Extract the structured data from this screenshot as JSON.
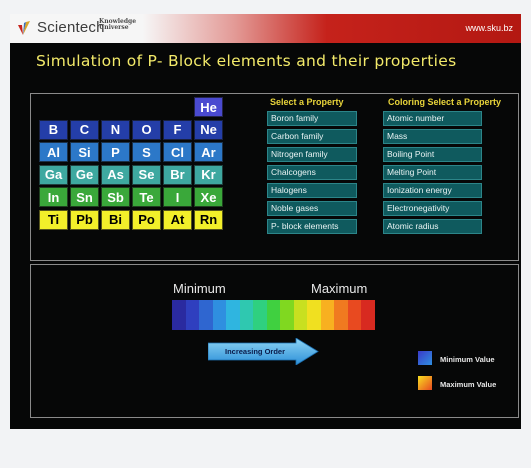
{
  "header": {
    "brand": "Scientech",
    "brand_sub_1": "Knowledge",
    "brand_sub_2": "Universe",
    "url": "www.sku.bz"
  },
  "title": "Simulation of P- Block elements and their properties",
  "periodic_table": {
    "elements": [
      {
        "symbol": "He",
        "row": 0,
        "col": 5,
        "color": "#4a4ad0"
      },
      {
        "symbol": "B",
        "row": 1,
        "col": 0,
        "color": "#243ea8"
      },
      {
        "symbol": "C",
        "row": 1,
        "col": 1,
        "color": "#243ea8"
      },
      {
        "symbol": "N",
        "row": 1,
        "col": 2,
        "color": "#243ea8"
      },
      {
        "symbol": "O",
        "row": 1,
        "col": 3,
        "color": "#243ea8"
      },
      {
        "symbol": "F",
        "row": 1,
        "col": 4,
        "color": "#243ea8"
      },
      {
        "symbol": "Ne",
        "row": 1,
        "col": 5,
        "color": "#243ea8"
      },
      {
        "symbol": "Al",
        "row": 2,
        "col": 0,
        "color": "#2c78c8"
      },
      {
        "symbol": "Si",
        "row": 2,
        "col": 1,
        "color": "#2c78c8"
      },
      {
        "symbol": "P",
        "row": 2,
        "col": 2,
        "color": "#2c78c8"
      },
      {
        "symbol": "S",
        "row": 2,
        "col": 3,
        "color": "#2c78c8"
      },
      {
        "symbol": "Cl",
        "row": 2,
        "col": 4,
        "color": "#2c78c8"
      },
      {
        "symbol": "Ar",
        "row": 2,
        "col": 5,
        "color": "#2c78c8"
      },
      {
        "symbol": "Ga",
        "row": 3,
        "col": 0,
        "color": "#3ea8a0"
      },
      {
        "symbol": "Ge",
        "row": 3,
        "col": 1,
        "color": "#3ea8a0"
      },
      {
        "symbol": "As",
        "row": 3,
        "col": 2,
        "color": "#3ea8a0"
      },
      {
        "symbol": "Se",
        "row": 3,
        "col": 3,
        "color": "#3ea8a0"
      },
      {
        "symbol": "Br",
        "row": 3,
        "col": 4,
        "color": "#3ea8a0"
      },
      {
        "symbol": "Kr",
        "row": 3,
        "col": 5,
        "color": "#3ea8a0"
      },
      {
        "symbol": "In",
        "row": 4,
        "col": 0,
        "color": "#3aa83a"
      },
      {
        "symbol": "Sn",
        "row": 4,
        "col": 1,
        "color": "#3aa83a"
      },
      {
        "symbol": "Sb",
        "row": 4,
        "col": 2,
        "color": "#3aa83a"
      },
      {
        "symbol": "Te",
        "row": 4,
        "col": 3,
        "color": "#3aa83a"
      },
      {
        "symbol": "I",
        "row": 4,
        "col": 4,
        "color": "#3aa83a"
      },
      {
        "symbol": "Xe",
        "row": 4,
        "col": 5,
        "color": "#3aa83a"
      },
      {
        "symbol": "Ti",
        "row": 5,
        "col": 0,
        "color": "#f2ef2a"
      },
      {
        "symbol": "Pb",
        "row": 5,
        "col": 1,
        "color": "#f2ef2a"
      },
      {
        "symbol": "Bi",
        "row": 5,
        "col": 2,
        "color": "#f2ef2a"
      },
      {
        "symbol": "Po",
        "row": 5,
        "col": 3,
        "color": "#f2ef2a"
      },
      {
        "symbol": "At",
        "row": 5,
        "col": 4,
        "color": "#f2ef2a"
      },
      {
        "symbol": "Rn",
        "row": 5,
        "col": 5,
        "color": "#f2ef2a"
      }
    ]
  },
  "property_panel": {
    "header": "Select a Property",
    "items": [
      "Boron family",
      "Carbon family",
      "Nitrogen family",
      "Chalcogens",
      "Halogens",
      "Noble gases",
      "P- block elements"
    ]
  },
  "coloring_panel": {
    "header": "Coloring Select a Property",
    "items": [
      "Atomic number",
      "Mass",
      "Boiling Point",
      "Melting Point",
      "Ionization energy",
      "Electronegativity",
      "Atomic radius"
    ]
  },
  "scale": {
    "min_label": "Minimum",
    "max_label": "Maximum",
    "colors": [
      "#2a2aa0",
      "#2f3fbf",
      "#2f66d0",
      "#2f8fe0",
      "#2fb5e0",
      "#2fc8b0",
      "#2fd080",
      "#40d040",
      "#80d820",
      "#c8e020",
      "#f0e020",
      "#f8b020",
      "#f07a20",
      "#e84a20",
      "#d82a20"
    ],
    "arrow_text": "Increasing Order"
  },
  "legend": {
    "min_text": "Minimum Value",
    "max_text": "Maximum Value"
  }
}
